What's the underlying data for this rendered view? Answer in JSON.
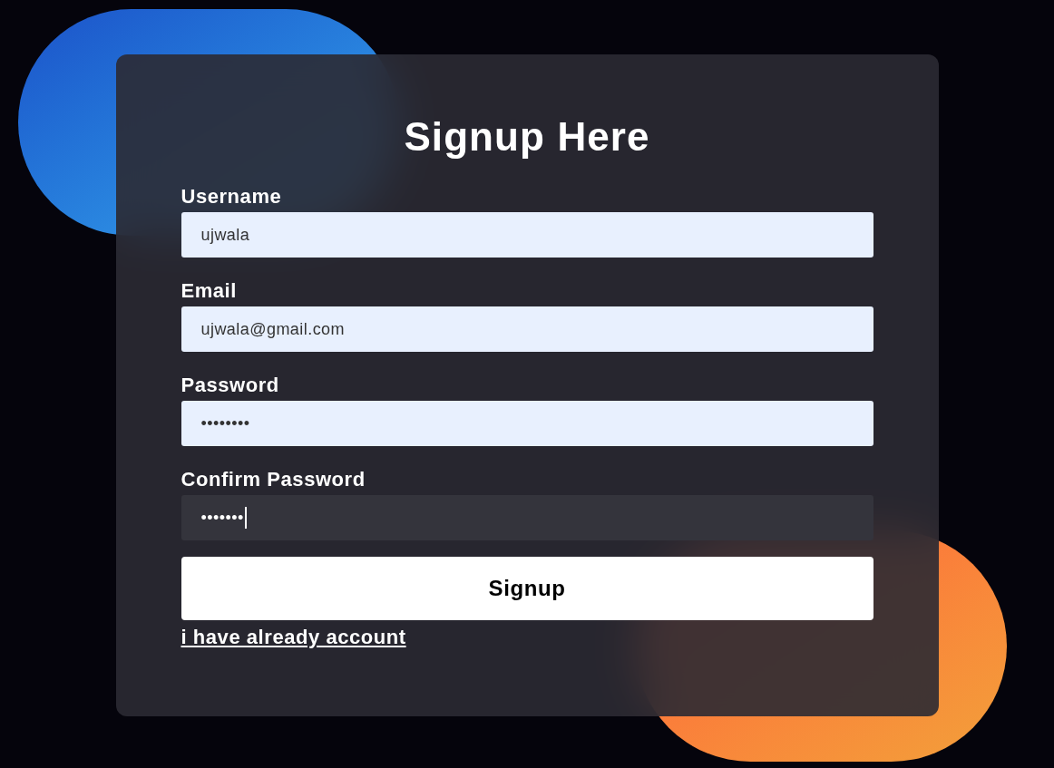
{
  "title": "Signup Here",
  "fields": [
    {
      "label": "Username",
      "value": "ujwala",
      "focused": false
    },
    {
      "label": "Email",
      "value": "ujwala@gmail.com",
      "focused": false
    },
    {
      "label": "Password",
      "value": "••••••••",
      "focused": false
    },
    {
      "label": "Confirm Password",
      "value": "•••••••",
      "focused": true
    }
  ],
  "submit": "Signup",
  "login_link": "i have already account"
}
